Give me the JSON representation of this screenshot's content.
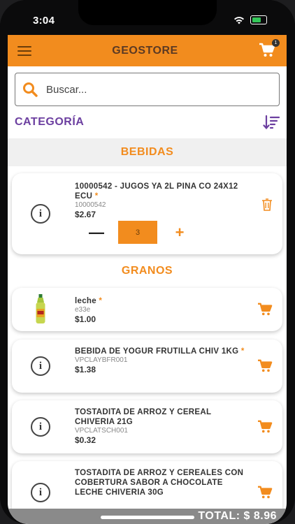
{
  "status": {
    "time": "3:04"
  },
  "app": {
    "title": "GEOSTORE",
    "cart_count": "1"
  },
  "search": {
    "placeholder": "Buscar..."
  },
  "category": {
    "label": "CATEGORÍA"
  },
  "sections": [
    {
      "name": "BEBIDAS",
      "items": [
        {
          "name": "10000542 - JUGOS YA 2L PINA CO 24X12 ECU",
          "star": "*",
          "code": "10000542",
          "price": "$2.67",
          "quantity": "3"
        }
      ]
    },
    {
      "name": "GRANOS",
      "items": [
        {
          "name": "leche",
          "star": "*",
          "code": "e33e",
          "price": "$1.00"
        },
        {
          "name": "BEBIDA DE YOGUR FRUTILLA CHIV 1KG",
          "star": "*",
          "code": "VPCLAYBFR001",
          "price": "$1.38"
        },
        {
          "name": "TOSTADITA DE ARROZ Y CEREAL CHIVERIA 21G",
          "code": "VPCLATSCH001",
          "price": "$0.32"
        },
        {
          "name": "TOSTADITA DE ARROZ Y CEREALES CON COBERTURA SABOR A CHOCOLATE LECHE CHIVERIA 30G"
        }
      ]
    }
  ],
  "total": {
    "label": "TOTAL: $ 8.96"
  },
  "colors": {
    "accent": "#f28c1e",
    "purple": "#6c3fa0",
    "total_bar": "#8a8a8a"
  }
}
